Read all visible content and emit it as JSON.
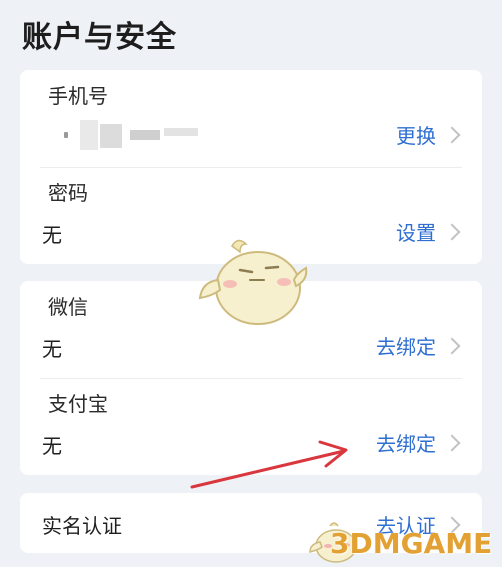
{
  "header": {
    "title": "账户与安全"
  },
  "card_account": {
    "phone": {
      "label": "手机号",
      "value": "",
      "action": "更换"
    },
    "password": {
      "label": "密码",
      "value": "无",
      "action": "设置"
    }
  },
  "card_binding": {
    "wechat": {
      "label": "微信",
      "value": "无",
      "action": "去绑定"
    },
    "alipay": {
      "label": "支付宝",
      "value": "无",
      "action": "去绑定"
    }
  },
  "card_verify": {
    "realname": {
      "label": "实名认证",
      "action": "去认证"
    }
  },
  "watermark": {
    "text": "3DMGAME"
  },
  "colors": {
    "background": "#eef1f6",
    "card": "#ffffff",
    "action_link": "#2f6fd1",
    "annotation_arrow": "#d9363e",
    "watermark": "#e2a132"
  },
  "icons": [
    "chevron-right-icon",
    "mascot-chick-icon",
    "annotation-arrow-icon"
  ]
}
